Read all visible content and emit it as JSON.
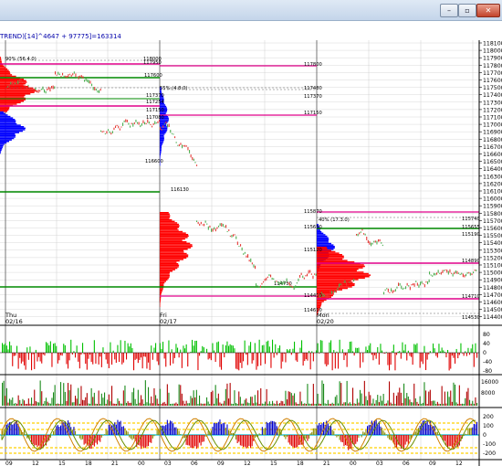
{
  "window": {
    "minimize_glyph": "–",
    "restore_glyph": "▫",
    "close_glyph": "✕"
  },
  "indicator_header": "TREND)[14]^4647 + 97775]=163314",
  "colors": {
    "accent_magenta": "#e0008a",
    "accent_green": "#008a00",
    "profile_red": "#ff0000",
    "profile_blue": "#0000ff"
  },
  "price_axis_labels": [
    "118100",
    "118000",
    "117900",
    "117800",
    "117700",
    "117600",
    "117500",
    "117400",
    "117300",
    "117200",
    "117100",
    "117000",
    "116900",
    "116800",
    "116700",
    "116600",
    "116500",
    "116400",
    "116300",
    "116200",
    "116100",
    "116000",
    "115900",
    "115800",
    "115700",
    "115600",
    "115500",
    "115400",
    "115300",
    "115200",
    "115100",
    "115000",
    "114900",
    "114800",
    "114700",
    "114600",
    "114500",
    "114400"
  ],
  "sessions": [
    {
      "weekday": "Thu",
      "date": "02/16"
    },
    {
      "weekday": "Fri",
      "date": "02/17"
    },
    {
      "weekday": "Mon",
      "date": "02/20"
    }
  ],
  "level_labels": [
    "118000",
    "117950",
    "117600",
    "117370",
    "117254",
    "117150",
    "117080",
    "116600",
    "116130",
    "117800",
    "117480",
    "117370",
    "117150",
    "115870",
    "115740",
    "115655",
    "115650",
    "115190",
    "115120",
    "114890",
    "114750",
    "114710",
    "114530",
    "114610",
    "114450"
  ],
  "profile_annotations": [
    "90% (56.4.0)",
    "55% (4.8.0)",
    "40% (17.3.0)"
  ],
  "osc1_axis": [
    "80",
    "40",
    "0",
    "-40",
    "-80"
  ],
  "osc2_axis": [
    "16000",
    "8000"
  ],
  "osc3_axis": [
    "200",
    "100",
    "0",
    "-100",
    "-200"
  ],
  "time_axis": [
    "09",
    "12",
    "15",
    "18",
    "21",
    "00",
    "03",
    "06",
    "09",
    "12",
    "15",
    "18",
    "21",
    "00",
    "03",
    "06",
    "09",
    "12"
  ]
}
